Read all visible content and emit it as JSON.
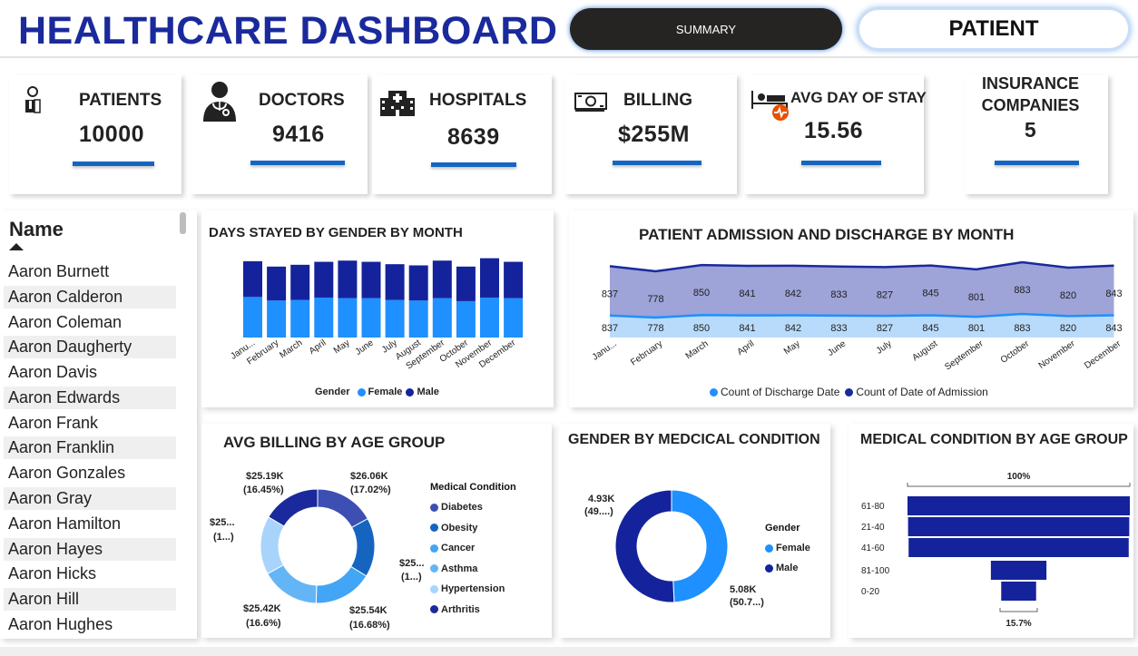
{
  "header": {
    "title": "HEALTHCARE DASHBOARD",
    "summary_button": "SUMMARY",
    "patient_button": "PATIENT"
  },
  "kpis": [
    {
      "label": "PATIENTS",
      "value": "10000",
      "icon": "patient-icon"
    },
    {
      "label": "DOCTORS",
      "value": "9416",
      "icon": "doctor-icon"
    },
    {
      "label": "HOSPITALS",
      "value": "8639",
      "icon": "hospital-icon"
    },
    {
      "label": "BILLING",
      "value": "$255M",
      "icon": "money-icon"
    },
    {
      "label": "AVG DAY OF STAY",
      "value": "15.56",
      "icon": "hospital-bed-icon"
    },
    {
      "label": "INSURANCE COMPANIES",
      "label_line1": "INSURANCE",
      "label_line2": "COMPANIES",
      "value": "5"
    }
  ],
  "name_slicer": {
    "header": "Name",
    "items": [
      "Aaron Burnett",
      "Aaron Calderon",
      "Aaron Coleman",
      "Aaron Daugherty",
      "Aaron Davis",
      "Aaron Edwards",
      "Aaron Frank",
      "Aaron Franklin",
      "Aaron Gonzales",
      "Aaron Gray",
      "Aaron Hamilton",
      "Aaron Hayes",
      "Aaron Hicks",
      "Aaron Hill",
      "Aaron Hughes"
    ]
  },
  "charts": {
    "days_stayed": {
      "title": "DAYS STAYED BY GENDER BY MONTH",
      "legend_title": "Gender",
      "legend": [
        "Female",
        "Male"
      ],
      "colors": {
        "Female": "#1e90ff",
        "Male": "#14239b"
      }
    },
    "admission": {
      "title": "PATIENT ADMISSION AND DISCHARGE BY MONTH",
      "legend": [
        "Count of Discharge Date",
        "Count of Date of Admission"
      ],
      "colors": {
        "discharge": "#1e90ff",
        "admission": "#1a2a9c",
        "admission_fill": "#9ea3d8",
        "discharge_fill": "#b9dbfb"
      }
    },
    "avg_billing": {
      "title": "AVG BILLING BY AGE GROUP",
      "legend_title": "Medical Condition",
      "legend": [
        "Diabetes",
        "Obesity",
        "Cancer",
        "Asthma",
        "Hypertension",
        "Arthritis"
      ],
      "labels": [
        {
          "value": "$26.06K",
          "pct": "(17.02%)"
        },
        {
          "value": "$25...",
          "pct": "(1...)"
        },
        {
          "value": "$25.54K",
          "pct": "(16.68%)"
        },
        {
          "value": "$25.42K",
          "pct": "(16.6%)"
        },
        {
          "value": "$25...",
          "pct": "(1...)"
        },
        {
          "value": "$25.19K",
          "pct": "(16.45%)"
        }
      ]
    },
    "gender_condition": {
      "title": "GENDER BY MEDCICAL CONDITION",
      "legend_title": "Gender",
      "legend": [
        "Female",
        "Male"
      ],
      "labels": [
        {
          "value": "4.93K",
          "pct": "(49....)"
        },
        {
          "value": "5.08K",
          "pct": "(50.7...)"
        }
      ]
    },
    "condition_age": {
      "title": "MEDICAL CONDITION BY AGE GROUP",
      "top_label": "100%",
      "bottom_label": "15.7%"
    }
  },
  "chart_data": [
    {
      "type": "bar",
      "title": "DAYS STAYED BY GENDER BY MONTH",
      "stacked": true,
      "categories": [
        "Janu...",
        "February",
        "March",
        "April",
        "May",
        "June",
        "July",
        "August",
        "September",
        "October",
        "November",
        "December"
      ],
      "series": [
        {
          "name": "Female",
          "values": [
            6800,
            6200,
            6300,
            6700,
            6600,
            6600,
            6300,
            6200,
            6600,
            6100,
            6700,
            6600
          ]
        },
        {
          "name": "Male",
          "values": [
            6000,
            5700,
            5900,
            6000,
            6300,
            6100,
            6000,
            5900,
            6300,
            5800,
            6600,
            6100
          ]
        }
      ],
      "ylim": [
        0,
        14000
      ]
    },
    {
      "type": "area",
      "title": "PATIENT ADMISSION AND DISCHARGE BY MONTH",
      "categories": [
        "Janu...",
        "February",
        "March",
        "April",
        "May",
        "June",
        "July",
        "August",
        "September",
        "October",
        "November",
        "December"
      ],
      "series": [
        {
          "name": "Count of Discharge Date",
          "values": [
            837,
            778,
            850,
            841,
            842,
            833,
            827,
            845,
            801,
            883,
            820,
            843
          ]
        },
        {
          "name": "Count of Date of Admission",
          "values": [
            837,
            778,
            850,
            841,
            842,
            833,
            827,
            845,
            801,
            883,
            820,
            843
          ]
        }
      ]
    },
    {
      "type": "pie",
      "title": "AVG BILLING BY AGE GROUP",
      "categories": [
        "Diabetes",
        "Obesity",
        "Cancer",
        "Asthma",
        "Hypertension",
        "Arthritis"
      ],
      "values": [
        26060,
        25600,
        25540,
        25420,
        25300,
        25190
      ],
      "percent": [
        17.02,
        16.7,
        16.68,
        16.6,
        16.53,
        16.45
      ],
      "colors": [
        "#3d4fb3",
        "#1565c0",
        "#42a5f5",
        "#64b5f6",
        "#a8d4fb",
        "#1a2a9c"
      ]
    },
    {
      "type": "pie",
      "title": "GENDER BY MEDCICAL CONDITION",
      "categories": [
        "Female",
        "Male"
      ],
      "values": [
        4930,
        5080
      ],
      "percent": [
        49.3,
        50.7
      ],
      "colors": [
        "#1e90ff",
        "#14239b"
      ]
    },
    {
      "type": "bar",
      "title": "MEDICAL CONDITION BY AGE GROUP",
      "orientation": "funnel",
      "categories": [
        "61-80",
        "21-40",
        "41-60",
        "81-100",
        "0-20"
      ],
      "values": [
        100,
        99.5,
        99,
        25,
        15.7
      ]
    }
  ]
}
